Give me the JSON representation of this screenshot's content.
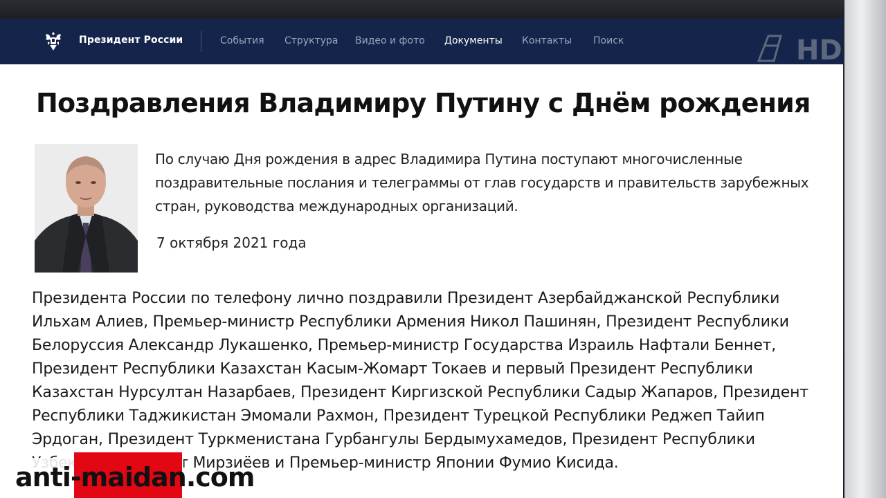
{
  "navbar": {
    "brand": "Президент России",
    "items": [
      {
        "label": "События"
      },
      {
        "label": "Структура"
      },
      {
        "label": "Видео и фото"
      },
      {
        "label": "Документы"
      },
      {
        "label": "Контакты"
      },
      {
        "label": "Поиск"
      }
    ],
    "active_item": "Документы"
  },
  "channel_logo": {
    "text": "HD",
    "icon": "channel-one-logo-icon"
  },
  "article": {
    "title": "Поздравления Владимиру Путину с Днём рождения",
    "lead": "По случаю Дня рождения в адрес Владимира Путина поступают многочисленные поздравительные послания и телеграммы от глав государств и правительств зарубежных стран, руководства международных организаций.",
    "date": "7 октября 2021 года",
    "body": "Президента России по телефону лично поздравили Президент Азербайджанской Республики Ильхам Алиев, Премьер-министр Республики Армения Никол Пашинян, Президент Республики Белоруссия Александр Лукашенко, Премьер-министр Государства Израиль Нафтали Беннет, Президент Республики Казахстан Касым-Жомарт Токаев и первый Президент Республики Казахстан Нурсултан Назарбаев, Президент Киргизской Республики Садыр Жапаров, Президент Республики Таджикистан Эмомали Рахмон, Президент Турецкой Республики Реджеп Тайип Эрдоган, Президент Туркменистана Гурбангулы Бердымухамедов, Президент Республики Узбекистан Шавкат Мирзиёев и Премьер-министр Японии Фумио Кисида."
  },
  "watermark": {
    "text": "anti-maidan.com"
  },
  "colors": {
    "navbar_bg": "#14244a",
    "accent_red": "#e30613"
  }
}
